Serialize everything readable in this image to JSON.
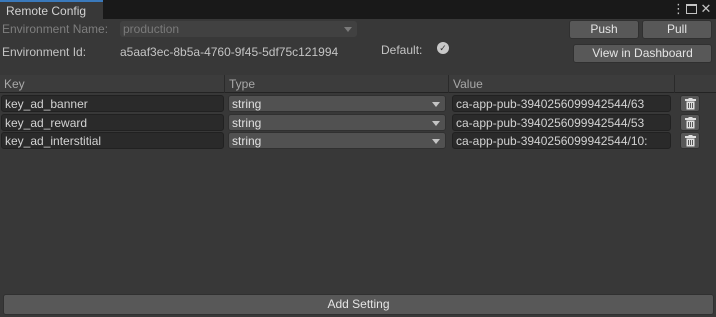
{
  "window": {
    "tab_title": "Remote Config",
    "menu_icon": "kebab-menu-icon",
    "maximize_icon": "maximize-icon",
    "close_icon": "close-icon"
  },
  "environment": {
    "name_label": "Environment Name:",
    "name_value": "production",
    "id_label": "Environment Id:",
    "id_value": "a5aaf3ec-8b5a-4760-9f45-5df75c121994",
    "default_label": "Default:",
    "default_checked": true
  },
  "toolbar": {
    "push_label": "Push",
    "pull_label": "Pull",
    "dashboard_label": "View in Dashboard"
  },
  "table": {
    "columns": [
      "Key",
      "Type",
      "Value"
    ],
    "rows": [
      {
        "key": "key_ad_banner",
        "type": "string",
        "value": "ca-app-pub-3940256099942544/63"
      },
      {
        "key": "key_ad_reward",
        "type": "string",
        "value": "ca-app-pub-3940256099942544/53"
      },
      {
        "key": "key_ad_interstitial",
        "type": "string",
        "value": "ca-app-pub-3940256099942544/10:"
      }
    ]
  },
  "footer": {
    "add_label": "Add Setting"
  },
  "colors": {
    "background": "#383838",
    "tab_accent": "#3a79bb",
    "button": "#585858",
    "field": "#2a2a2a"
  }
}
